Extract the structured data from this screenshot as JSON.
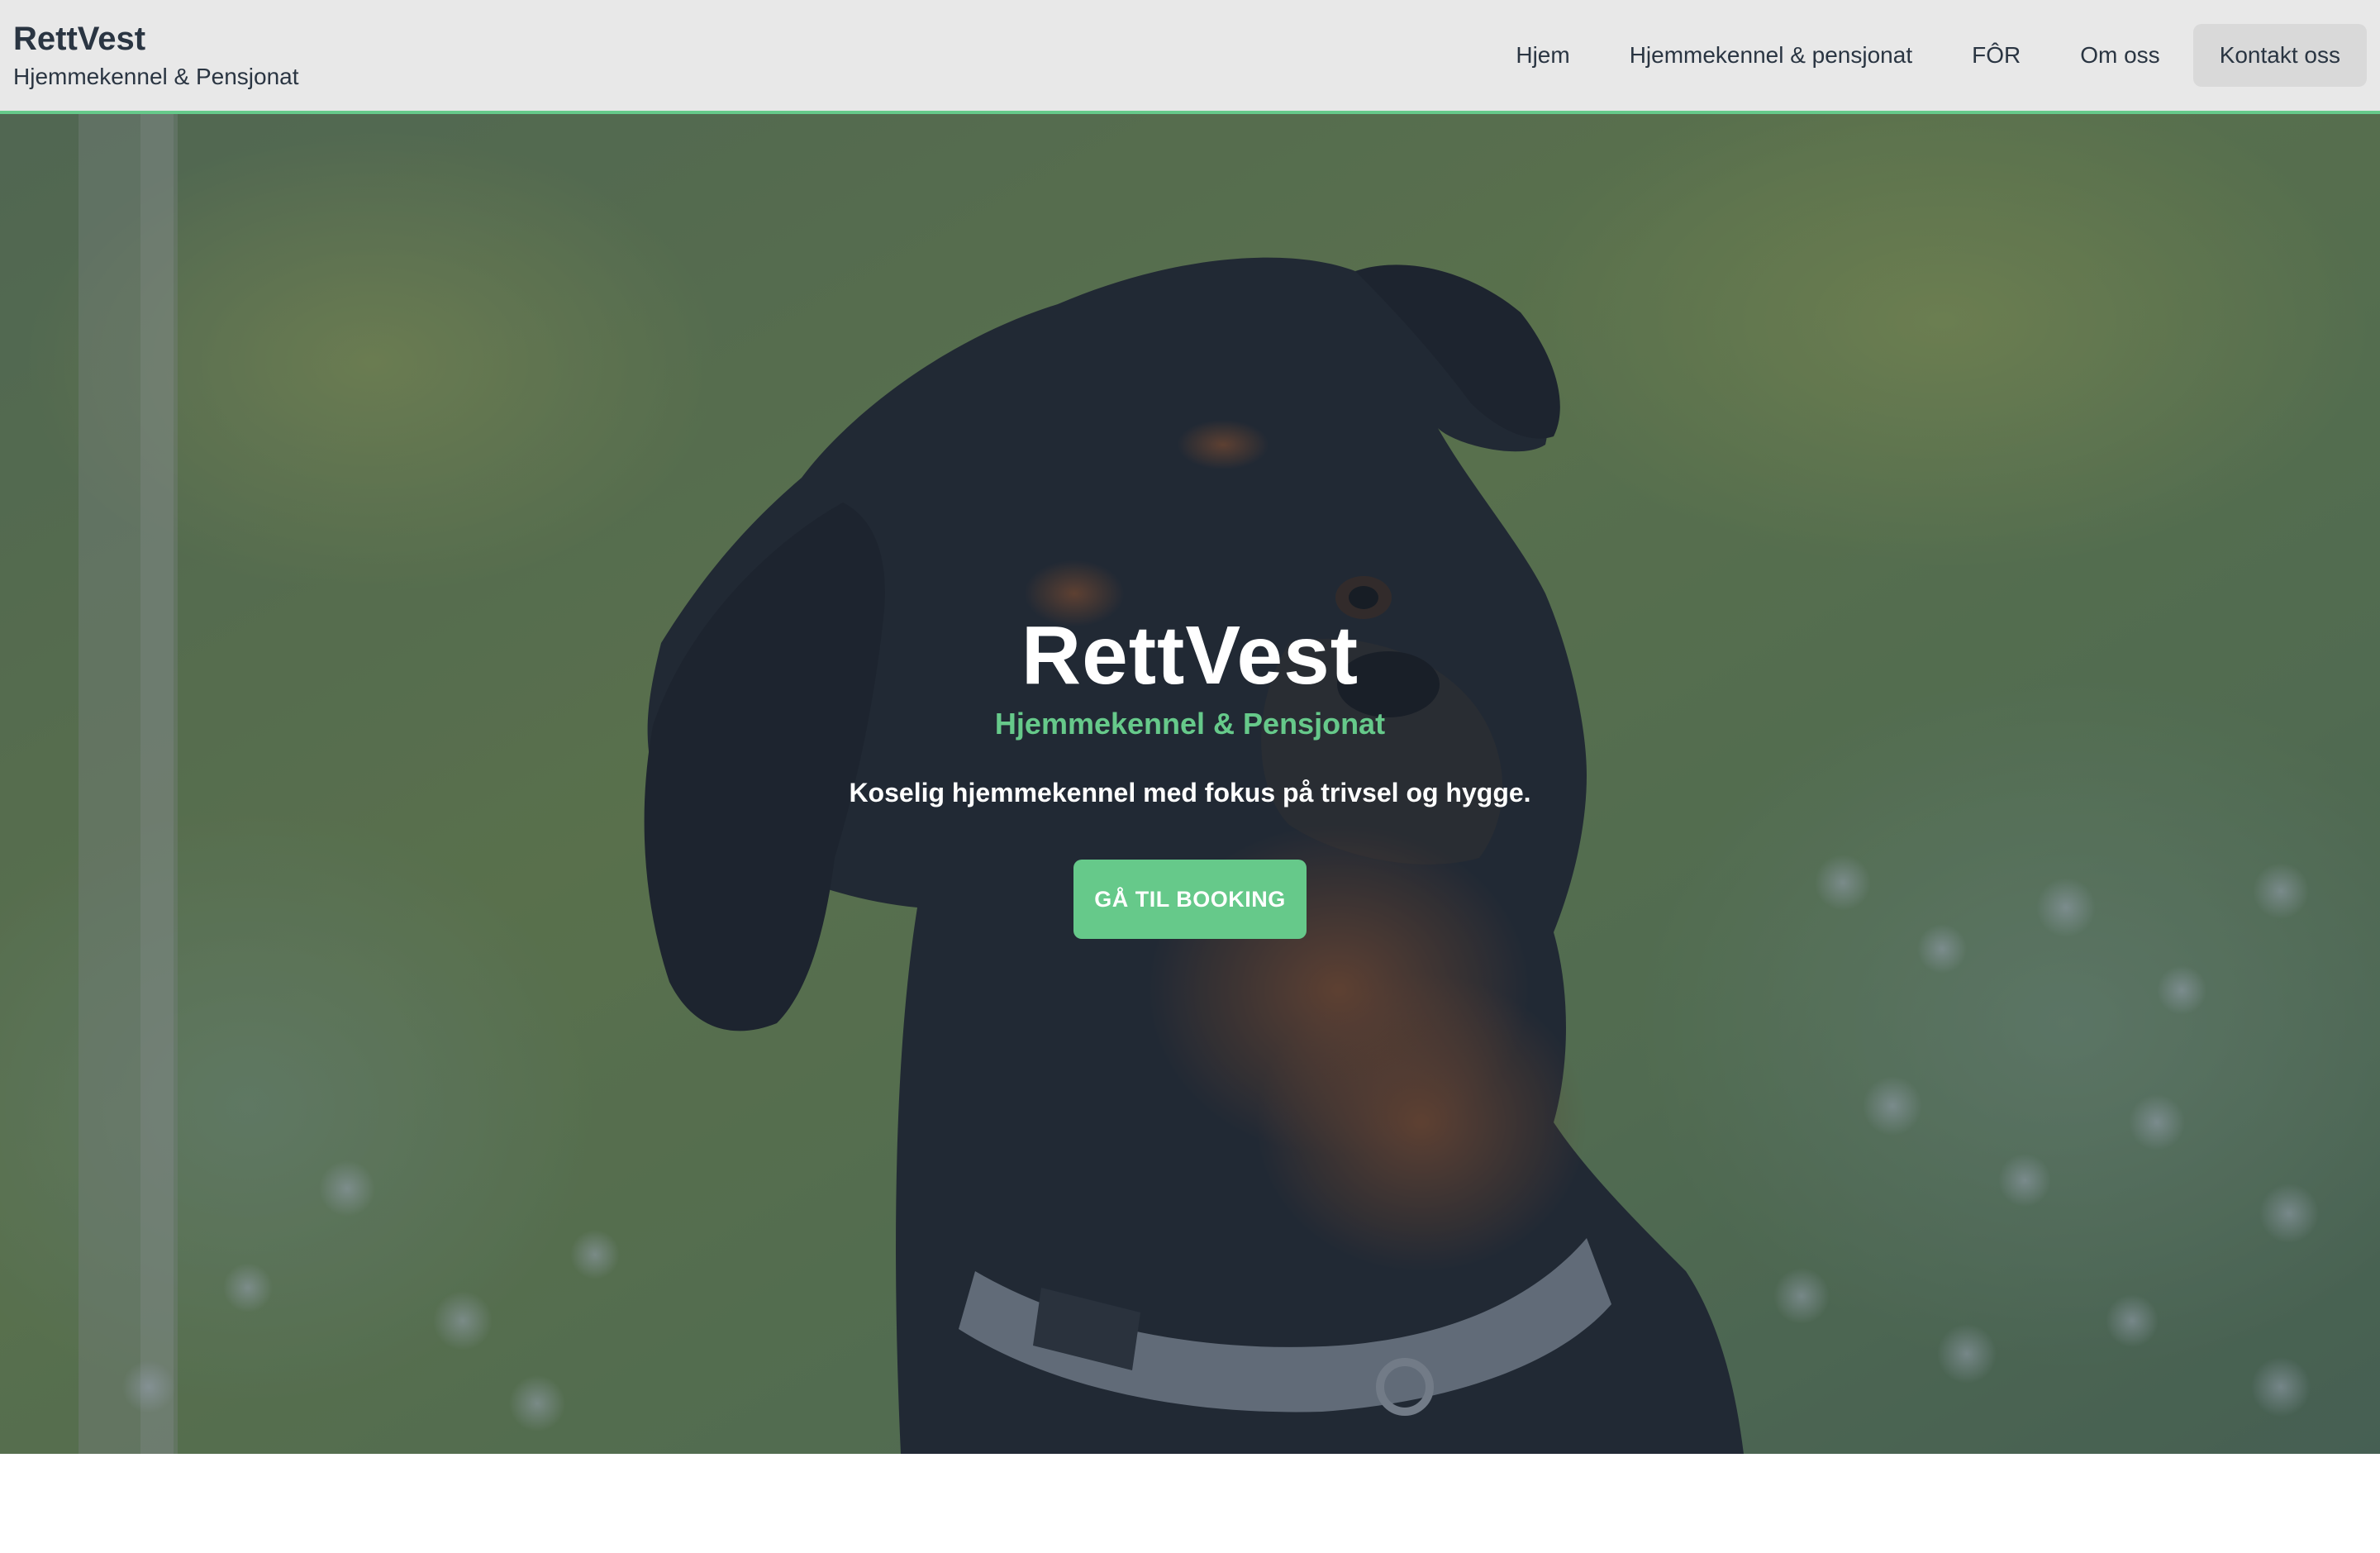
{
  "header": {
    "brand_title": "RettVest",
    "brand_subtitle": "Hjemmekennel & Pensjonat",
    "nav": [
      {
        "label": "Hjem"
      },
      {
        "label": "Hjemmekennel & pensjonat"
      },
      {
        "label": "FÔR"
      },
      {
        "label": "Om oss"
      },
      {
        "label": "Kontakt oss"
      }
    ]
  },
  "hero": {
    "title": "RettVest",
    "subtitle": "Hjemmekennel & Pensjonat",
    "tagline": "Koselig hjemmekennel med fokus på trivsel og hygge.",
    "button_label": "GÅ TIL BOOKING",
    "image_subject": "rottweiler-dog-photo"
  },
  "colors": {
    "accent": "#66c98a",
    "header_bg": "#e8e8e8",
    "text_dark": "#2a3542"
  }
}
